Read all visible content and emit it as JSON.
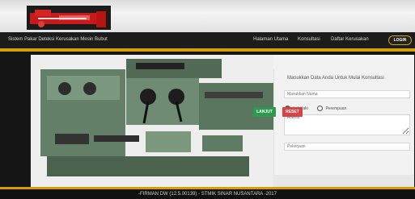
{
  "header": {
    "app_title": "Sistem Pakar Deteksi Kerusakan Mesin Bubut",
    "nav": [
      "Halaman Utama",
      "Konsultasi",
      "Daftar Kerusakan"
    ],
    "login_label": "LOGIN"
  },
  "form": {
    "title": "Masukkan Data Anda Untuk Mulai Konsultasi",
    "nama_placeholder": "Masukkan Nama",
    "gender_options": [
      "Laki-laki",
      "Perempuan"
    ],
    "gender_selected": "Laki-laki",
    "alamat_placeholder": "Alamat",
    "pekerjaan_placeholder": "Pekerjaan",
    "submit_label": "LANJUT",
    "reset_label": "RESET"
  },
  "footer": {
    "credit": "-FIRMAN DW (12.5.00139) - STMIK SINAR NUSANTARA -2017"
  },
  "colors": {
    "accent": "#d59f00",
    "navbar": "#1c1c1c",
    "submit": "#2e9a4e",
    "reset": "#d54446"
  },
  "icons": {
    "logo": "lathe-machine-logo"
  }
}
